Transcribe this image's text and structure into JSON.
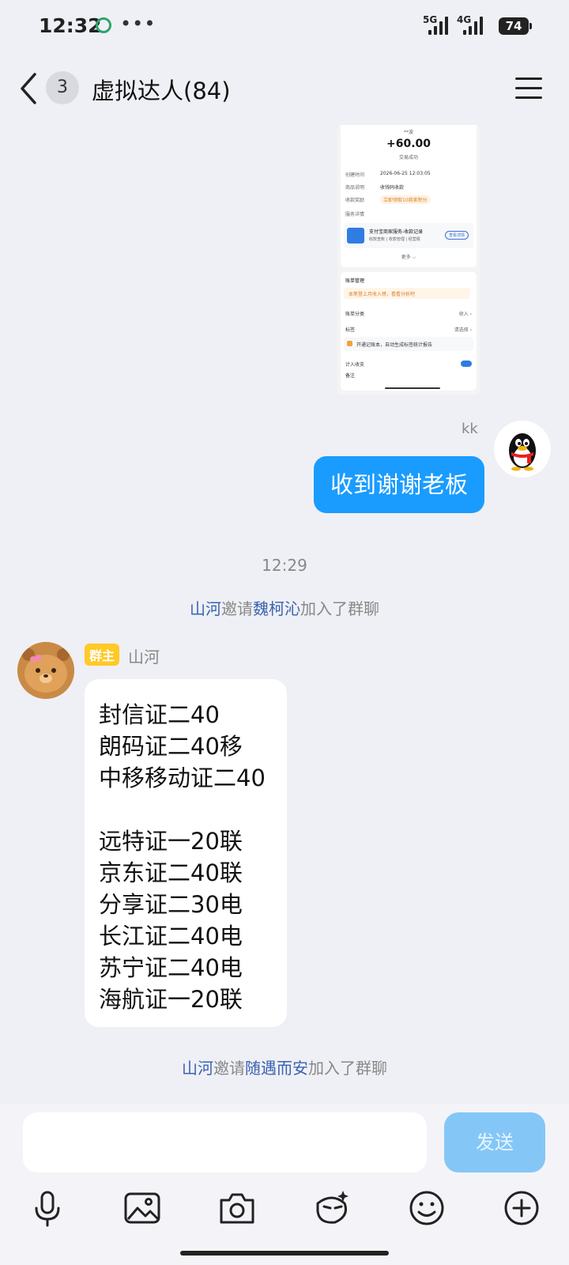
{
  "status_bar": {
    "time": "12:32",
    "dots": "•••",
    "net1": "5G",
    "net2": "4G",
    "battery": "74"
  },
  "header": {
    "unread_count": "3",
    "title": "虚拟达人(84)"
  },
  "receipt_image": {
    "payer": "**波",
    "amount": "+60.00",
    "status": "交易成功",
    "rows": [
      {
        "label": "创建时间",
        "value": "2026-06-25 12:03:05"
      },
      {
        "label": "商品说明",
        "value": "收钱码收款"
      },
      {
        "label": "收款奖励",
        "value": "立即领取10商家积分"
      },
      {
        "label": "服务详情",
        "value": ""
      }
    ],
    "service_title": "支付宝商家服务-收款记录",
    "service_sub": "收款查账 | 收款管理 | 经营报",
    "service_btn": "查看详情",
    "more": "更多 ⌵",
    "bill_mgmt": "账单管理",
    "bill_tip": "本笔登上月收入榜，看看分析吧",
    "bill_cat": "账单分类",
    "bill_cat_val": "收入 ›",
    "tag": "标签",
    "tag_val": "请选择 ›",
    "tag_tip": "开通记账本，自动生成标签统计报告",
    "count_in": "计入收支",
    "remark": "备注"
  },
  "messages": {
    "kk_sender": "kk",
    "kk_text": "收到谢谢老板",
    "timestamp": "12:29",
    "sys1": {
      "inviter": "山河",
      "mid": "邀请",
      "invitee": "魏柯沁",
      "tail": "加入了群聊"
    },
    "owner_badge": "群主",
    "owner_name": "山河",
    "owner_lines": [
      "封信证二40",
      "朗码证二40移",
      "中移移动证二40",
      "远特证一20联",
      "京东证二40联",
      "分享证二30电",
      "长江证二40电",
      "苏宁证二40电",
      "海航证一20联"
    ],
    "sys2": {
      "inviter": "山河",
      "mid": "邀请",
      "invitee": "随遇而安",
      "tail": "加入了群聊"
    }
  },
  "input": {
    "placeholder": "",
    "send_label": "发送"
  },
  "colors": {
    "accent_blue": "#1a9cff",
    "send_disabled": "#84c7f7",
    "owner_badge": "#ffc928",
    "link_user": "#3a62b0"
  }
}
